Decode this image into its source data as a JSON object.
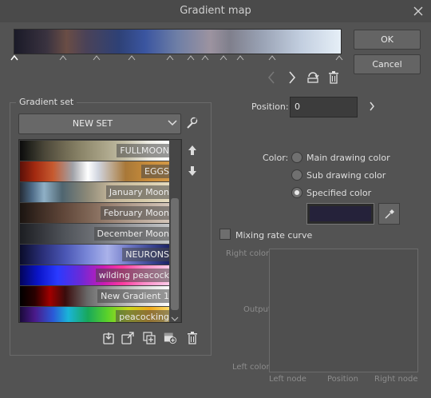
{
  "window": {
    "title": "Gradient map"
  },
  "buttons": {
    "ok": "OK",
    "cancel": "Cancel"
  },
  "position": {
    "label": "Position:",
    "value": "0"
  },
  "gradient_set": {
    "label": "Gradient set",
    "selected": "NEW SET",
    "items": [
      {
        "name": "FULLMOON"
      },
      {
        "name": "EGGS"
      },
      {
        "name": "January Moon"
      },
      {
        "name": "February Moon"
      },
      {
        "name": "December Moon"
      },
      {
        "name": "NEURONS"
      },
      {
        "name": "wilding peacock"
      },
      {
        "name": "New Gradient 1"
      },
      {
        "name": "peacocking"
      }
    ]
  },
  "color": {
    "label": "Color:",
    "options": [
      "Main drawing color",
      "Sub drawing color",
      "Specified color"
    ],
    "selected": "Specified color",
    "specified_swatch": "#25223a"
  },
  "mixing": {
    "label": "Mixing rate curve",
    "checked": false
  },
  "graph": {
    "right_color": "Right color",
    "output": "Output",
    "left_color": "Left color",
    "left_node": "Left node",
    "position": "Position",
    "right_node": "Right node"
  }
}
